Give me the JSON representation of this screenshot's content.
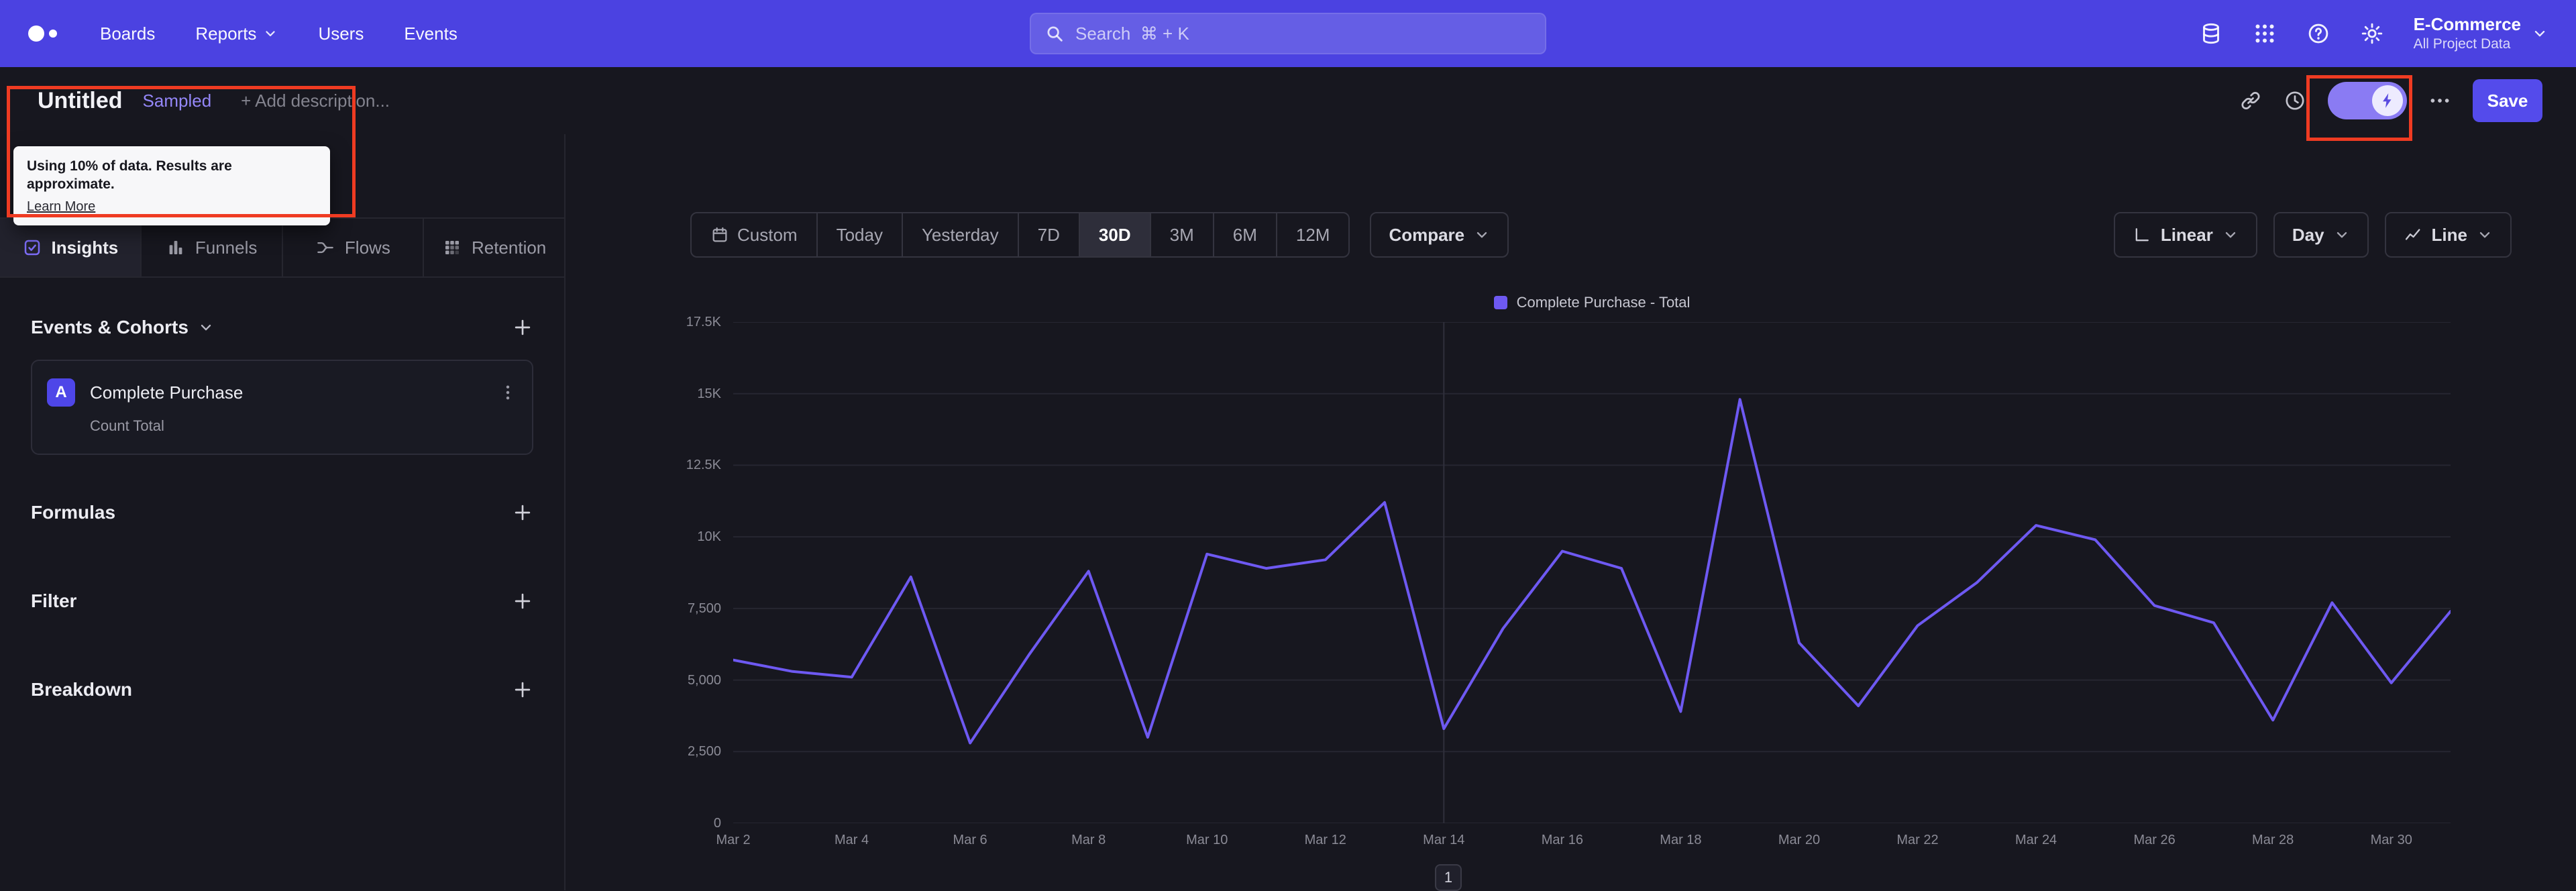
{
  "topnav": {
    "nav_items": [
      {
        "label": "Boards"
      },
      {
        "label": "Reports"
      },
      {
        "label": "Users"
      },
      {
        "label": "Events"
      }
    ],
    "search_placeholder": "Search  ⌘ + K",
    "project_name": "E-Commerce",
    "project_scope": "All Project Data"
  },
  "doc_header": {
    "title": "Untitled",
    "badge": "Sampled",
    "description_placeholder": "+ Add description...",
    "save_label": "Save"
  },
  "sampling_tooltip": {
    "message": "Using 10% of data. Results are approximate.",
    "link_label": "Learn More"
  },
  "sidebar": {
    "tabs": [
      {
        "label": "Insights",
        "active": true
      },
      {
        "label": "Funnels",
        "active": false
      },
      {
        "label": "Flows",
        "active": false
      },
      {
        "label": "Retention",
        "active": false
      }
    ],
    "events_title": "Events & Cohorts",
    "event_card": {
      "badge": "A",
      "name": "Complete Purchase",
      "metric": "Count Total"
    },
    "sections": [
      {
        "label": "Formulas"
      },
      {
        "label": "Filter"
      },
      {
        "label": "Breakdown"
      }
    ]
  },
  "controls": {
    "date_buttons": [
      "Custom",
      "Today",
      "Yesterday",
      "7D",
      "30D",
      "3M",
      "6M",
      "12M"
    ],
    "active_date": "30D",
    "compare": "Compare",
    "view_dropdowns": [
      {
        "label": "Linear"
      },
      {
        "label": "Day"
      },
      {
        "label": "Line"
      }
    ]
  },
  "pagination": {
    "current_page": "1"
  },
  "chart_data": {
    "type": "line",
    "title": "",
    "legend": [
      {
        "label": "Complete Purchase - Total",
        "color": "#6E59F2"
      }
    ],
    "x_unit": "day of March",
    "day_start": 2,
    "day_end": 31,
    "x_tick_days": [
      2,
      4,
      6,
      8,
      10,
      12,
      14,
      16,
      18,
      20,
      22,
      24,
      26,
      28,
      30
    ],
    "x_tick_labels": [
      "Mar 2",
      "Mar 4",
      "Mar 6",
      "Mar 8",
      "Mar 10",
      "Mar 12",
      "Mar 14",
      "Mar 16",
      "Mar 18",
      "Mar 20",
      "Mar 22",
      "Mar 24",
      "Mar 26",
      "Mar 28",
      "Mar 30"
    ],
    "ylim": [
      0,
      17500
    ],
    "y_ticks": [
      {
        "label": "0",
        "value": 0
      },
      {
        "label": "2,500",
        "value": 2500
      },
      {
        "label": "5,000",
        "value": 5000
      },
      {
        "label": "7,500",
        "value": 7500
      },
      {
        "label": "10K",
        "value": 10000
      },
      {
        "label": "12.5K",
        "value": 12500
      },
      {
        "label": "15K",
        "value": 15000
      },
      {
        "label": "17.5K",
        "value": 17500
      }
    ],
    "grid": true,
    "legend_position": "top-center",
    "vline_day": 14,
    "series": [
      {
        "name": "Complete Purchase - Total",
        "color": "#6E59F2",
        "days": [
          2,
          3,
          4,
          5,
          6,
          7,
          8,
          9,
          10,
          11,
          12,
          13,
          14,
          15,
          16,
          17,
          18,
          19,
          20,
          21,
          22,
          23,
          24,
          25,
          26,
          27,
          28,
          29,
          30,
          31
        ],
        "values": [
          5700,
          5300,
          5100,
          8600,
          2800,
          5900,
          8800,
          3000,
          9400,
          8900,
          9200,
          11200,
          3300,
          6800,
          9500,
          8900,
          3900,
          14800,
          6300,
          4100,
          6900,
          8400,
          10400,
          9900,
          7600,
          7000,
          3600,
          7700,
          4900,
          7400
        ]
      }
    ]
  },
  "icons": {
    "logo": "two-dots",
    "search": "magnifier",
    "data_management": "database-stack",
    "apps": "dot-grid",
    "help": "question-circle",
    "settings": "gear",
    "copy_link": "chain-link",
    "history": "clock",
    "sampling_toggle": "lightning-bolt",
    "more_options": "horizontal-ellipsis",
    "insights": "checkbox-check",
    "funnels": "bar-columns",
    "flows": "split-paths",
    "retention": "dot-matrix",
    "add": "plus",
    "event_options": "vertical-kebab",
    "custom_date": "calendar",
    "linear_scale": "axes",
    "chart_type": "trend-line",
    "chevron": "chevron-down"
  },
  "colors": {
    "topnav_bg": "#4B42E1",
    "page_bg": "#17171F",
    "accent": "#544BEB",
    "line": "#6E59F2",
    "annotation": "#EF3B22",
    "sampled_badge": "#9487F8"
  }
}
